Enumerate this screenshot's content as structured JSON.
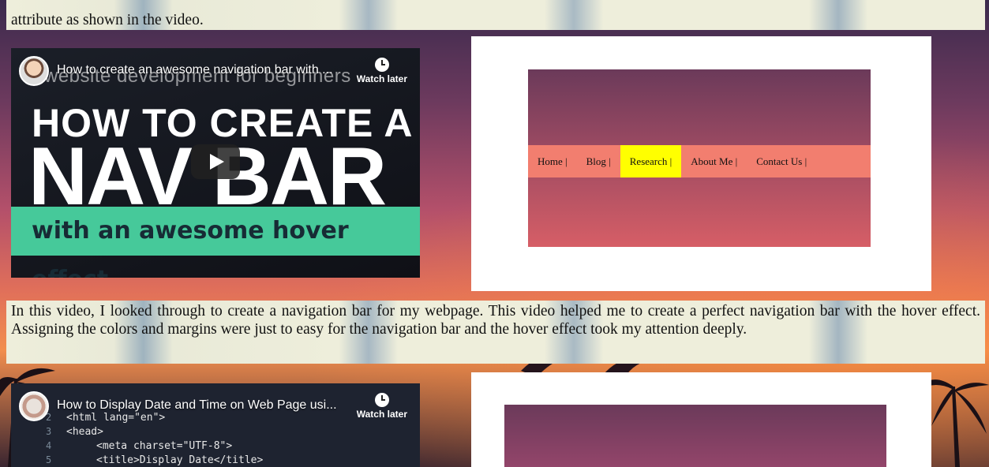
{
  "top_text": "attribute as shown in the video.",
  "video1": {
    "title": "How to create an awesome navigation bar with ...",
    "watch_later": "Watch later",
    "thumb_subtitle": "website development for beginners",
    "thumb_line1": "HOW TO CREATE A",
    "thumb_line2": "NAV BAR",
    "thumb_line3": "with an awesome hover effect"
  },
  "preview1": {
    "nav_items": [
      "Home |",
      "Blog |",
      "Research |",
      "About Me |",
      "Contact Us |"
    ],
    "active_index": 2
  },
  "middle_text": "In this video, I looked through to create a navigation bar for my webpage. This video helped me to create a perfect navigation bar with the hover effect. Assigning the colors and margins were just to easy for the navigation bar and the hover effect took my attention deeply.",
  "video2": {
    "title": "How to Display Date and Time on Web Page usi...",
    "watch_later": "Watch later",
    "code": [
      {
        "no": "2",
        "text": "<html lang=\"en\">"
      },
      {
        "no": "3",
        "text": "<head>"
      },
      {
        "no": "4",
        "text": "<meta charset=\"UTF-8\">"
      },
      {
        "no": "5",
        "text": "<title>Display Date</title>"
      }
    ]
  },
  "colors": {
    "text_strip": "#eeeedb",
    "nav_bar": "#f27e6f",
    "nav_active": "#ffff00",
    "thumb_band": "#46c99a"
  }
}
